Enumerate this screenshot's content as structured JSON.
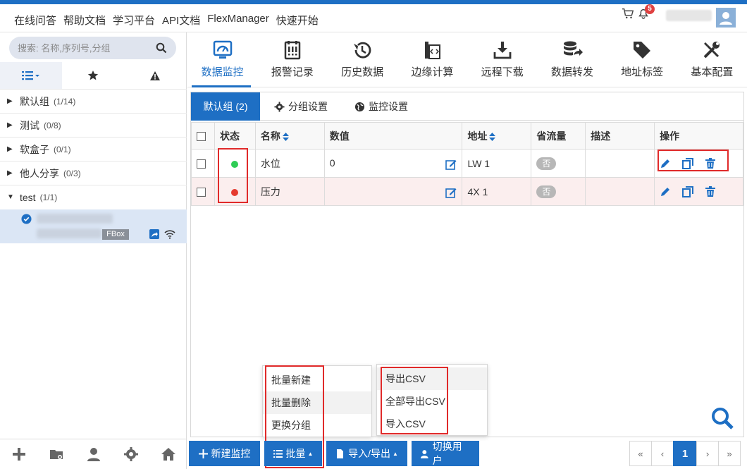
{
  "topnav": [
    "在线问答",
    "帮助文档",
    "学习平台",
    "API文档",
    "FlexManager",
    "快速开始"
  ],
  "header": {
    "notification_count": "5"
  },
  "sidebar": {
    "search_placeholder": "搜索: 名称,序列号,分组",
    "groups": [
      {
        "name": "默认组",
        "count": "(1/14)",
        "expanded": false
      },
      {
        "name": "测试",
        "count": "(0/8)",
        "expanded": false
      },
      {
        "name": "软盒子",
        "count": "(0/1)",
        "expanded": false
      },
      {
        "name": "他人分享",
        "count": "(0/3)",
        "expanded": false
      },
      {
        "name": "test",
        "count": "(1/1)",
        "expanded": true
      }
    ],
    "device": {
      "tag": "FBox"
    }
  },
  "toolbar": {
    "items": [
      "数据监控",
      "报警记录",
      "历史数据",
      "边缘计算",
      "远程下载",
      "数据转发",
      "地址标签",
      "基本配置"
    ],
    "active": 0
  },
  "panel": {
    "tabs": [
      "默认组 (2)",
      "分组设置",
      "监控设置"
    ],
    "columns": [
      "状态",
      "名称",
      "数值",
      "地址",
      "省流量",
      "描述",
      "操作"
    ],
    "rows": [
      {
        "status": "online",
        "status_color": "#2ecc55",
        "name": "水位",
        "value": "0",
        "address": "LW 1",
        "save_flow": "否",
        "desc": ""
      },
      {
        "status": "offline",
        "status_color": "#e53a2f",
        "name": "压力",
        "value": "",
        "address": "4X 1",
        "save_flow": "否",
        "desc": ""
      }
    ]
  },
  "batch_menu": [
    "批量新建",
    "批量删除",
    "更换分组"
  ],
  "io_menu": [
    "导出CSV",
    "全部导出CSV",
    "导入CSV"
  ],
  "bottom": {
    "new_label": "新建监控",
    "batch_label": "批量",
    "io_label": "导入/导出",
    "switch_label": "切换用户"
  },
  "pager": {
    "first": "«",
    "prev": "‹",
    "current": "1",
    "next": "›",
    "last": "»"
  },
  "colors": {
    "primary": "#1e6fc4",
    "highlight": "#e02a2a"
  }
}
